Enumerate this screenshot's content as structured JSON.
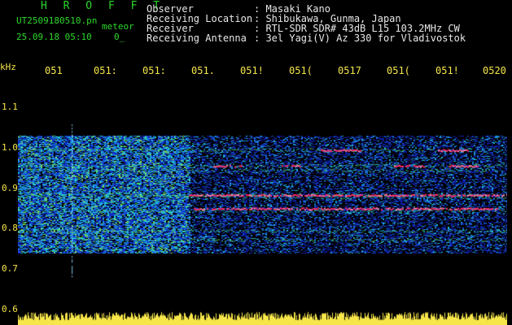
{
  "header": {
    "title": "H R O F F T",
    "file_name": "UT2509180510.pn",
    "event_type": "meteor",
    "date_time": "25.09.18 05:10",
    "date_trail": "0_"
  },
  "station": [
    {
      "label": "Observer",
      "value": ": Masaki Kano"
    },
    {
      "label": "Receiving Location",
      "value": ": Shibukawa, Gunma, Japan"
    },
    {
      "label": "Receiver",
      "value": ": RTL-SDR SDR# 43dB L15 103.2MHz CW"
    },
    {
      "label": "Receiving Antenna",
      "value": ": 3el Yagi(V) Az 330 for Vladivostok"
    }
  ],
  "colors": {
    "accent_green": "#2bd82b",
    "axis_yellow": "#f6e64a",
    "text_white": "#e8e8e8"
  },
  "chart_data": {
    "type": "heatmap",
    "y_unit": "kHz",
    "y_ticks": [
      "1.1",
      "1.0",
      "0.9",
      "0.8",
      "0.7",
      "0.6"
    ],
    "ylim": [
      0.6,
      1.15
    ],
    "x_ticks": [
      "051",
      "051:",
      "051:",
      "051.",
      "051!",
      "051(",
      "0517",
      "051(",
      "051!",
      "0520"
    ],
    "signal_bands_khz": [
      0.99,
      0.955,
      0.945,
      0.89,
      0.885,
      0.855,
      0.81,
      0.79
    ],
    "hot_segments": [
      {
        "f": 0.99,
        "x0": 0.62,
        "x1": 0.7
      },
      {
        "f": 0.99,
        "x0": 0.86,
        "x1": 0.92
      },
      {
        "f": 0.955,
        "x0": 0.4,
        "x1": 0.46
      },
      {
        "f": 0.955,
        "x0": 0.54,
        "x1": 0.58
      },
      {
        "f": 0.955,
        "x0": 0.77,
        "x1": 0.83
      },
      {
        "f": 0.955,
        "x0": 0.88,
        "x1": 0.94
      },
      {
        "f": 0.89,
        "x0": 0.35,
        "x1": 1.0
      },
      {
        "f": 0.86,
        "x0": 0.36,
        "x1": 0.98
      }
    ],
    "meteor_trace_x": 0.11,
    "noise_floor_color": "#f6e64a"
  }
}
